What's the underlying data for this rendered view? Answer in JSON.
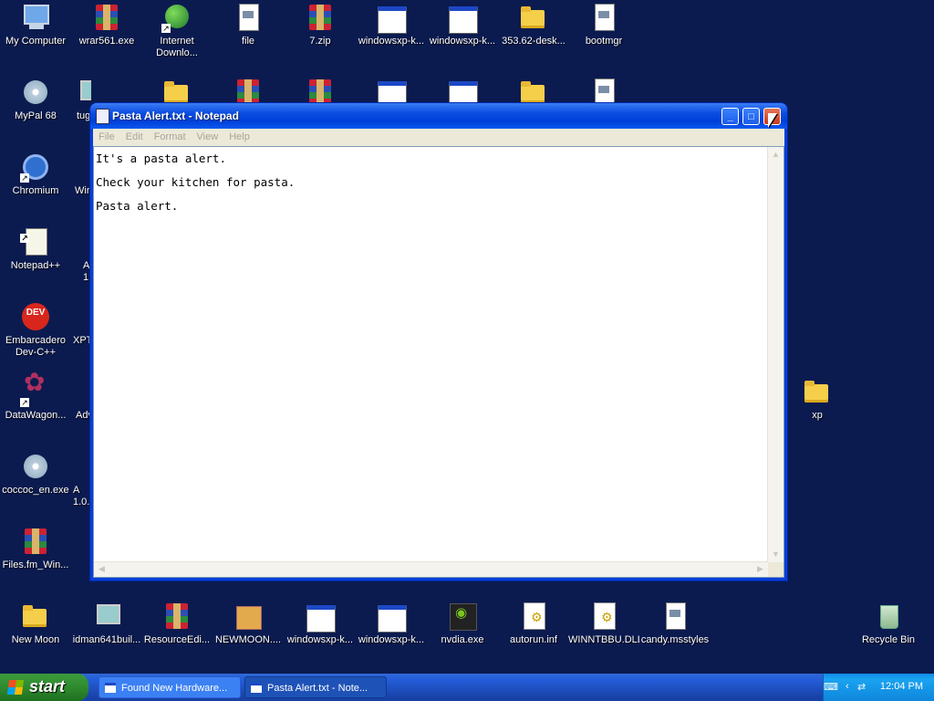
{
  "desktop_icons": [
    {
      "label": "My Computer",
      "icon": "computer-icon"
    },
    {
      "label": "wrar561.exe",
      "icon": "winrar-icon"
    },
    {
      "label": "Internet Downlo...",
      "icon": "globe-icon"
    },
    {
      "label": "file",
      "icon": "file-icon"
    },
    {
      "label": "7.zip",
      "icon": "winrar-icon"
    },
    {
      "label": "windowsxp-k...",
      "icon": "window-icon"
    },
    {
      "label": "windowsxp-k...",
      "icon": "window-icon"
    },
    {
      "label": "353.62-desk...",
      "icon": "folder-icon"
    },
    {
      "label": "bootmgr",
      "icon": "file-icon"
    },
    {
      "label": "MyPal 68",
      "icon": "raccoon-icon"
    },
    {
      "label": "tug",
      "icon": "setup-icon"
    },
    {
      "label": "Chromium",
      "icon": "chromium-icon"
    },
    {
      "label": "Win",
      "icon": "app-icon"
    },
    {
      "label": "Notepad++",
      "icon": "notepadpp-icon"
    },
    {
      "label": "A 1",
      "icon": "app-icon"
    },
    {
      "label": "Embarcadero Dev-C++",
      "icon": "devcpp-icon"
    },
    {
      "label": "XPT",
      "icon": "app-icon"
    },
    {
      "label": "DataWagon...",
      "icon": "flower-icon"
    },
    {
      "label": "Adv",
      "icon": "app-icon"
    },
    {
      "label": "coccoc_en.exe",
      "icon": "cd-icon"
    },
    {
      "label": "A 1.0.",
      "icon": "app-icon"
    },
    {
      "label": "Files.fm_Win...",
      "icon": "winrar-icon"
    },
    {
      "label": "xp",
      "icon": "folder-icon"
    },
    {
      "label": "New Moon",
      "icon": "folder-icon"
    },
    {
      "label": "idman641buil...",
      "icon": "setup-icon"
    },
    {
      "label": "ResourceEdi...",
      "icon": "winrar-icon"
    },
    {
      "label": "NEWMOON....",
      "icon": "package-icon"
    },
    {
      "label": "windowsxp-k...",
      "icon": "window-icon"
    },
    {
      "label": "windowsxp-k...",
      "icon": "window-icon"
    },
    {
      "label": "nvdia.exe",
      "icon": "nvidia-icon"
    },
    {
      "label": "autorun.inf",
      "icon": "inf-icon"
    },
    {
      "label": "WINNTBBU.DLL",
      "icon": "dll-icon"
    },
    {
      "label": "candy.msstyles",
      "icon": "msstyles-icon"
    },
    {
      "label": "Recycle Bin",
      "icon": "recycle-bin-icon"
    }
  ],
  "notepad": {
    "title": "Pasta Alert.txt - Notepad",
    "menu": [
      "File",
      "Edit",
      "Format",
      "View",
      "Help"
    ],
    "lines": [
      "It's a pasta alert.",
      "Check your kitchen for pasta.",
      "Pasta alert."
    ],
    "buttons": {
      "minimize": "_",
      "maximize": "□",
      "close": "✕"
    }
  },
  "taskbar": {
    "start_label": "start",
    "tasks": [
      {
        "label": "Found New Hardware...",
        "active": false
      },
      {
        "label": "Pasta Alert.txt - Note...",
        "active": true
      }
    ],
    "clock": "12:04 PM"
  }
}
